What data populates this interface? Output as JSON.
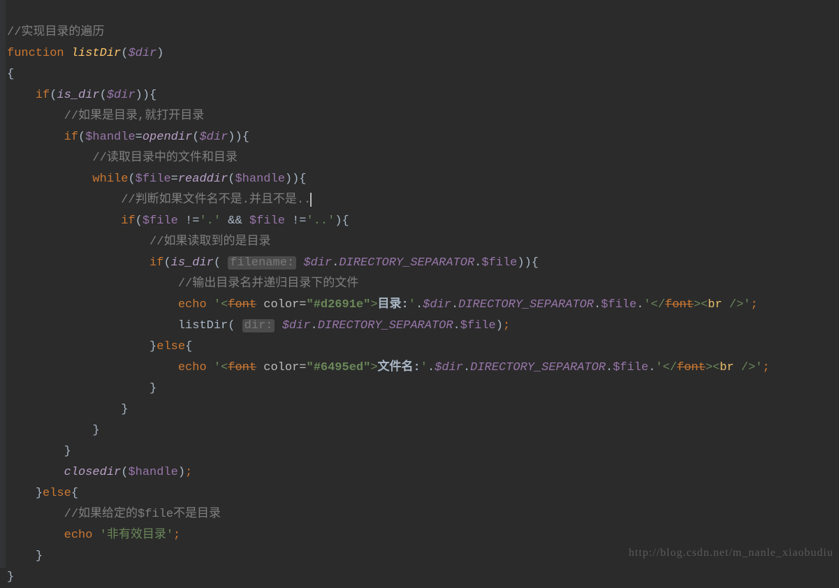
{
  "lines": {
    "l1_comment": "//实现目录的遍历",
    "l2_function": "function",
    "l2_name": "listDir",
    "l2_param": "$dir",
    "l4_if": "if",
    "l4_isdir": "is_dir",
    "l4_dir": "$dir",
    "l5_comment": "//如果是目录,就打开目录",
    "l6_if": "if",
    "l6_handle": "$handle",
    "l6_opendir": "opendir",
    "l6_dir": "$dir",
    "l7_comment": "//读取目录中的文件和目录",
    "l8_while": "while",
    "l8_file": "$file",
    "l8_readdir": "readdir",
    "l8_handle": "$handle",
    "l9_comment": "//判断如果文件名不是.并且不是..",
    "l10_if": "if",
    "l10_file1": "$file",
    "l10_neq1": "!=",
    "l10_dot": "'.'",
    "l10_and": "&&",
    "l10_file2": "$file",
    "l10_neq2": "!=",
    "l10_dotdot": "'..'",
    "l11_comment": "//如果读取到的是目录",
    "l12_if": "if",
    "l12_isdir": "is_dir",
    "l12_hint": "filename:",
    "l12_dir": "$dir",
    "l12_sep": "DIRECTORY_SEPARATOR",
    "l12_file": "$file",
    "l13_comment": "//输出目录名并递归目录下的文件",
    "l14_echo": "echo",
    "l14_q1": "'",
    "l14_lt1": "<",
    "l14_font1": "font",
    "l14_color": "color=",
    "l14_colorval": "\"#d2691e\"",
    "l14_gt1": ">",
    "l14_label": "目录:",
    "l14_q2": "'",
    "l14_dir": "$dir",
    "l14_sep": "DIRECTORY_SEPARATOR",
    "l14_file": "$file",
    "l14_q3": "'",
    "l14_ltc": "</",
    "l14_font2": "font",
    "l14_gtc": ">",
    "l14_lt2": "<",
    "l14_br": "br",
    "l14_sl": " /",
    "l14_gt2": ">",
    "l14_q4": "'",
    "l15_listdir": "listDir",
    "l15_hint": "dir:",
    "l15_dir": "$dir",
    "l15_sep": "DIRECTORY_SEPARATOR",
    "l15_file": "$file",
    "l16_else": "else",
    "l17_echo": "echo",
    "l17_colorval": "\"#6495ed\"",
    "l17_label": "文件名:",
    "l17_dir": "$dir",
    "l17_sep": "DIRECTORY_SEPARATOR",
    "l17_file": "$file",
    "l21_closedir": "closedir",
    "l21_handle": "$handle",
    "l22_else": "else",
    "l23_comment": "//如果给定的$file不是目录",
    "l24_echo": "echo",
    "l24_str": "'非有效目录'"
  },
  "watermark": "http://blog.csdn.net/m_nanle_xiaobudiu"
}
